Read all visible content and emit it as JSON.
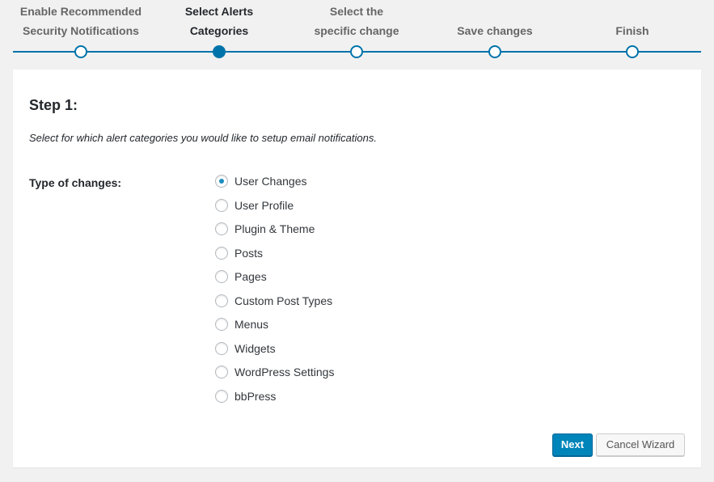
{
  "wizard": {
    "steps": [
      {
        "label_line1": "Enable Recommended",
        "label_line2": "Security Notifications"
      },
      {
        "label_line1": "Select Alerts",
        "label_line2": "Categories"
      },
      {
        "label_line1": "Select the",
        "label_line2": "specific change"
      },
      {
        "label_line1": "",
        "label_line2": "Save changes"
      },
      {
        "label_line1": "",
        "label_line2": "Finish"
      }
    ],
    "active_step": 2,
    "accent_color": "#0073aa"
  },
  "panel": {
    "title": "Step 1:",
    "description": "Select for which alert categories you would like to setup email notifications.",
    "field_label": "Type of changes:",
    "options": [
      {
        "label": "User Changes",
        "checked": true
      },
      {
        "label": "User Profile",
        "checked": false
      },
      {
        "label": "Plugin & Theme",
        "checked": false
      },
      {
        "label": "Posts",
        "checked": false
      },
      {
        "label": "Pages",
        "checked": false
      },
      {
        "label": "Custom Post Types",
        "checked": false
      },
      {
        "label": "Menus",
        "checked": false
      },
      {
        "label": "Widgets",
        "checked": false
      },
      {
        "label": "WordPress Settings",
        "checked": false
      },
      {
        "label": "bbPress",
        "checked": false
      }
    ]
  },
  "buttons": {
    "next_label": "Next",
    "cancel_label": "Cancel Wizard",
    "primary_color": "#0085ba"
  }
}
